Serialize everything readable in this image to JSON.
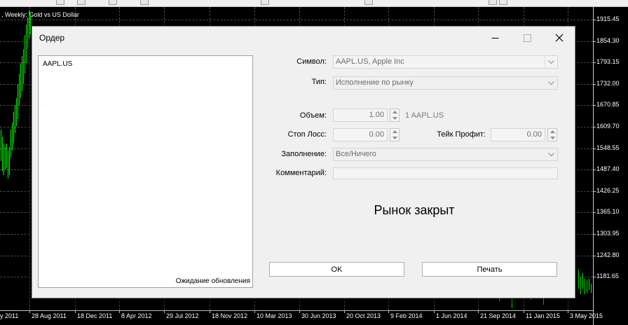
{
  "chart": {
    "title": ", Weekly: Gold vs US Dollar",
    "price_labels": [
      "1915.45",
      "1854.30",
      "1793.15",
      "1732.00",
      "1670.85",
      "1609.70",
      "1548.55",
      "1487.40",
      "1426.25",
      "1365.10",
      "1303.95",
      "1242.80",
      "1181.65"
    ],
    "time_labels": [
      "y 2011",
      "28 Aug 2011",
      "18 Dec 2011",
      "8 Apr 2012",
      "29 Jul 2012",
      "18 Nov 2012",
      "10 Mar 2013",
      "30 Jun 2013",
      "20 Oct 2013",
      "9 Feb 2014",
      "1 Jun 2014",
      "21 Sep 2014",
      "11 Jan 2015",
      "3 May 2015"
    ],
    "candle_color": "#00ff00"
  },
  "dialog": {
    "title": "Ордер",
    "symbol_list": {
      "items": [
        "AAPL.US"
      ],
      "status": "Ожидание обновления"
    },
    "form": {
      "symbol_label": "Символ:",
      "symbol_value": "AAPL.US, Apple Inc",
      "type_label": "Тип:",
      "type_value": "Исполнение по рынку",
      "volume_label": "Объем:",
      "volume_value": "1.00",
      "volume_unit": "1 AAPL.US",
      "stoploss_label": "Стоп Лосс:",
      "stoploss_value": "0.00",
      "takeprofit_label": "Тейк Профит:",
      "takeprofit_value": "0.00",
      "filling_label": "Заполнение:",
      "filling_value": "Все/Ничего",
      "comment_label": "Комментарий:",
      "comment_value": ""
    },
    "status_message": "Рынок закрыт",
    "buttons": {
      "ok": "OK",
      "print": "Печать"
    }
  }
}
